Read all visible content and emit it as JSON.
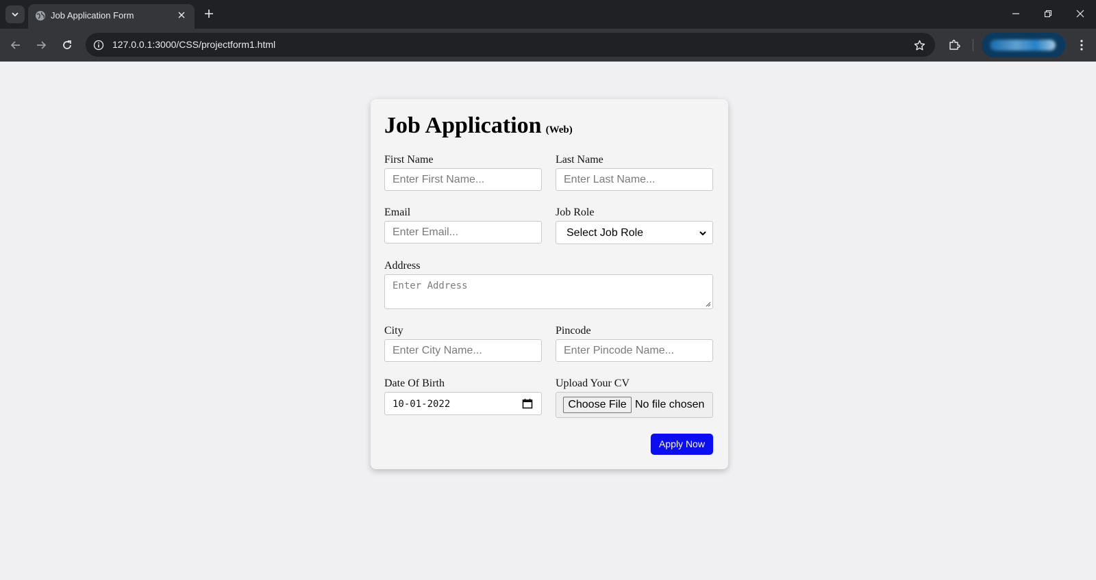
{
  "browser": {
    "tab_title": "Job Application Form",
    "url": "127.0.0.1:3000/CSS/projectform1.html"
  },
  "form": {
    "title": "Job Application",
    "subtitle": "(Web)",
    "first_name": {
      "label": "First Name",
      "placeholder": "Enter First Name..."
    },
    "last_name": {
      "label": "Last Name",
      "placeholder": "Enter Last Name..."
    },
    "email": {
      "label": "Email",
      "placeholder": "Enter Email..."
    },
    "job_role": {
      "label": "Job Role",
      "selected": "Select Job Role"
    },
    "address": {
      "label": "Address",
      "placeholder": "Enter Address"
    },
    "city": {
      "label": "City",
      "placeholder": "Enter City Name..."
    },
    "pincode": {
      "label": "Pincode",
      "placeholder": "Enter Pincode Name..."
    },
    "dob": {
      "label": "Date Of Birth",
      "value": "10-01-2022"
    },
    "cv": {
      "label": "Upload Your CV",
      "button": "Choose File",
      "status": "No file chosen"
    },
    "submit_label": "Apply Now"
  },
  "colors": {
    "page_bg": "#f0eff2",
    "card_bg": "#f4f4f4",
    "submit_bg": "#0a0ef0",
    "chrome_dark": "#202124"
  }
}
